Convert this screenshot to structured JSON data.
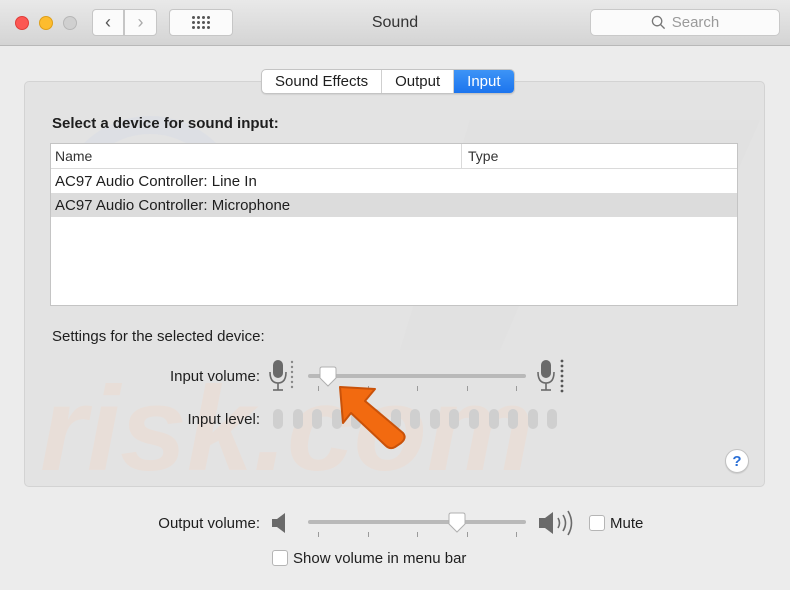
{
  "window": {
    "title": "Sound",
    "search_placeholder": "Search",
    "nav": {
      "back": "‹",
      "forward": "›"
    }
  },
  "tabs": [
    {
      "label": "Sound Effects",
      "active": false
    },
    {
      "label": "Output",
      "active": false
    },
    {
      "label": "Input",
      "active": true
    }
  ],
  "input": {
    "section_title": "Select a device for sound input:",
    "columns": [
      "Name",
      "Type"
    ],
    "devices": [
      {
        "name": "AC97 Audio Controller: Line In",
        "type": "",
        "selected": false
      },
      {
        "name": "AC97 Audio Controller: Microphone",
        "type": "",
        "selected": true
      }
    ],
    "settings_label": "Settings for the selected device:",
    "input_volume_label": "Input volume:",
    "input_volume_percent": 5,
    "input_level_label": "Input level:",
    "input_level_segments": 15,
    "input_level_active": 0
  },
  "help_label": "?",
  "output": {
    "volume_label": "Output volume:",
    "volume_percent": 70,
    "mute_label": "Mute",
    "mute_checked": false,
    "show_in_menu_bar_label": "Show volume in menu bar",
    "show_in_menu_bar_checked": false
  },
  "colors": {
    "accent": "#1c74ee",
    "annotation_arrow": "#f26a10",
    "close": "#fc5753",
    "minimize": "#fdbc2e"
  }
}
